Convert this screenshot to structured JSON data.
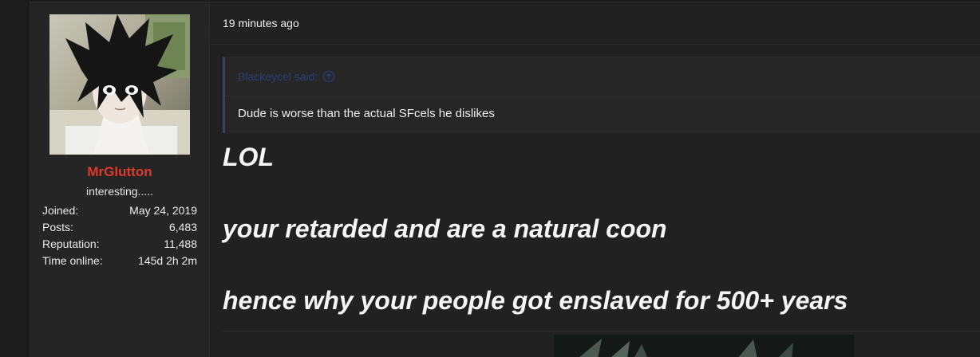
{
  "user": {
    "username": "MrGlutton",
    "title": "interesting.....",
    "stats": [
      {
        "label": "Joined:",
        "value": "May 24, 2019"
      },
      {
        "label": "Posts:",
        "value": "6,483"
      },
      {
        "label": "Reputation:",
        "value": "11,488"
      },
      {
        "label": "Time online:",
        "value": "145d 2h 2m"
      }
    ]
  },
  "post": {
    "date": "19 minutes ago",
    "quote": {
      "author": "Blackeycel said:",
      "text": "Dude is worse than the actual SFcels he dislikes"
    },
    "lines": [
      "LOL",
      "your retarded and are a natural coon",
      "hence why your people got enslaved for 500+ years"
    ]
  },
  "colors": {
    "username": "#e0392b",
    "quote_author": "#2b3e7a",
    "quote_border": "#364172"
  }
}
